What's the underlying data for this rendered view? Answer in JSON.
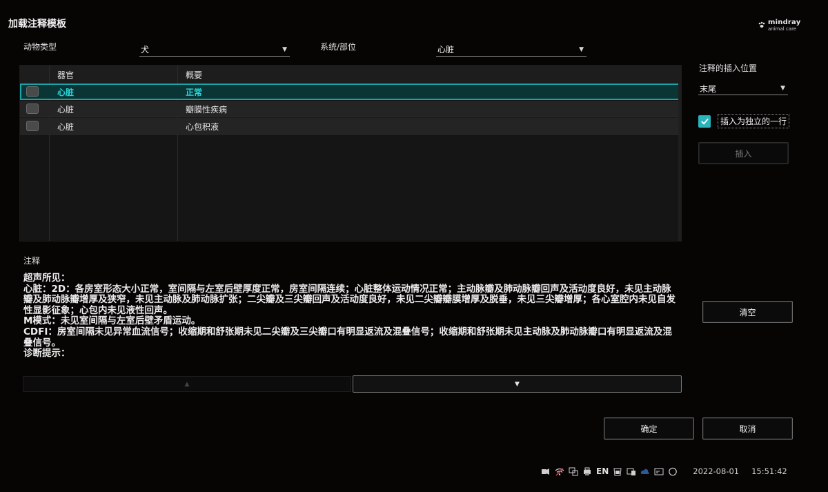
{
  "dialog": {
    "title": "加载注释模板",
    "logo": {
      "brand": "mindray",
      "sub": "animal care"
    }
  },
  "filters": {
    "animal_type_label": "动物类型",
    "animal_type_value": "犬",
    "system_label": "系统/部位",
    "system_value": "心脏"
  },
  "table": {
    "headers": [
      "器官",
      "概要"
    ],
    "rows": [
      {
        "organ": "心脏",
        "summary": "正常",
        "selected": true
      },
      {
        "organ": "心脏",
        "summary": "瓣膜性疾病",
        "selected": false
      },
      {
        "organ": "心脏",
        "summary": "心包积液",
        "selected": false
      }
    ]
  },
  "insert_panel": {
    "position_label": "注释的插入位置",
    "position_value": "末尾",
    "independent_line_label": "插入为独立的一行",
    "independent_line_checked": true,
    "insert_button": "插入",
    "clear_button": "清空"
  },
  "annotation": {
    "label": "注释",
    "lines": [
      "超声所见：",
      "心脏：2D：各房室形态大小正常，室间隔与左室后壁厚度正常，房室间隔连续；心脏整体运动情况正常；主动脉瓣及肺动脉瓣回声及活动度良好，未见主动脉瓣及肺动脉瓣增厚及狭窄，未见主动脉及肺动脉扩张；二尖瓣及三尖瓣回声及活动度良好，未见二尖瓣瓣膜增厚及脱垂，未见三尖瓣增厚；各心室腔内未见自发性显影征象；心包内未见液性回声。",
      "M模式：未见室间隔与左室后壁矛盾运动。",
      "CDFI：房室间隔未见异常血流信号；收缩期和舒张期未见二尖瓣及三尖瓣口有明显返流及混叠信号；收缩期和舒张期未见主动脉及肺动脉瓣口有明显返流及混叠信号。",
      "诊断提示："
    ]
  },
  "pager": {
    "up": "▲",
    "down": "▼"
  },
  "footer": {
    "ok_button": "确定",
    "cancel_button": "取消"
  },
  "status_bar": {
    "language": "EN",
    "date": "2022-08-01",
    "time": "15:51:42",
    "icons": [
      "usb-icon",
      "wifi-icon",
      "network-icon",
      "printer-icon",
      "battery-icon",
      "storage-icon",
      "cloud-icon",
      "screen-icon",
      "status-circle-icon"
    ]
  },
  "colors": {
    "accent": "#1aa3a8",
    "selected_text": "#28d6dc",
    "background": "#070404"
  }
}
